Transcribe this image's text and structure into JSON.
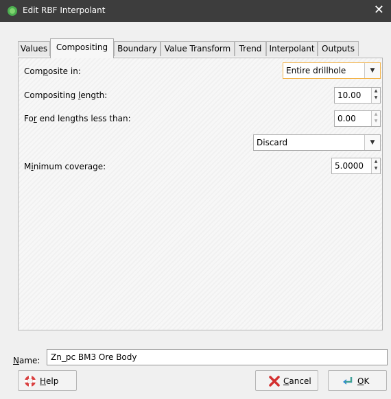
{
  "window": {
    "title": "Edit RBF Interpolant",
    "close_glyph": "✕"
  },
  "tabs": [
    {
      "label": "Values",
      "active": false
    },
    {
      "label": "Compositing",
      "active": true
    },
    {
      "label": "Boundary",
      "active": false
    },
    {
      "label": "Value Transform",
      "active": false
    },
    {
      "label": "Trend",
      "active": false
    },
    {
      "label": "Interpolant",
      "active": false
    },
    {
      "label": "Outputs",
      "active": false
    }
  ],
  "compositing": {
    "composite_in_pre": "Com",
    "composite_in_mnemonic": "p",
    "composite_in_post": "osite in:",
    "composite_in_value": "Entire drillhole",
    "length_pre": "Compositing ",
    "length_mnemonic": "l",
    "length_post": "ength:",
    "length_value": "10.00",
    "end_pre": "Fo",
    "end_mnemonic": "r",
    "end_post": " end lengths less than:",
    "end_value": "0.00",
    "end_action": "Discard",
    "coverage_pre": "M",
    "coverage_mnemonic": "i",
    "coverage_post": "nimum coverage:",
    "coverage_value": "5.0000"
  },
  "name": {
    "label_mnemonic": "N",
    "label_rest": "ame:",
    "value": "Zn_pc BM3 Ore Body"
  },
  "buttons": {
    "help_mnemonic": "H",
    "help_rest": "elp",
    "cancel_mnemonic": "C",
    "cancel_rest": "ancel",
    "ok_mnemonic": "O",
    "ok_rest": "K"
  },
  "icons": {
    "app": "app-logo-icon",
    "help": "lifebuoy-icon",
    "cancel": "red-x-icon",
    "ok": "green-return-arrow-icon"
  }
}
